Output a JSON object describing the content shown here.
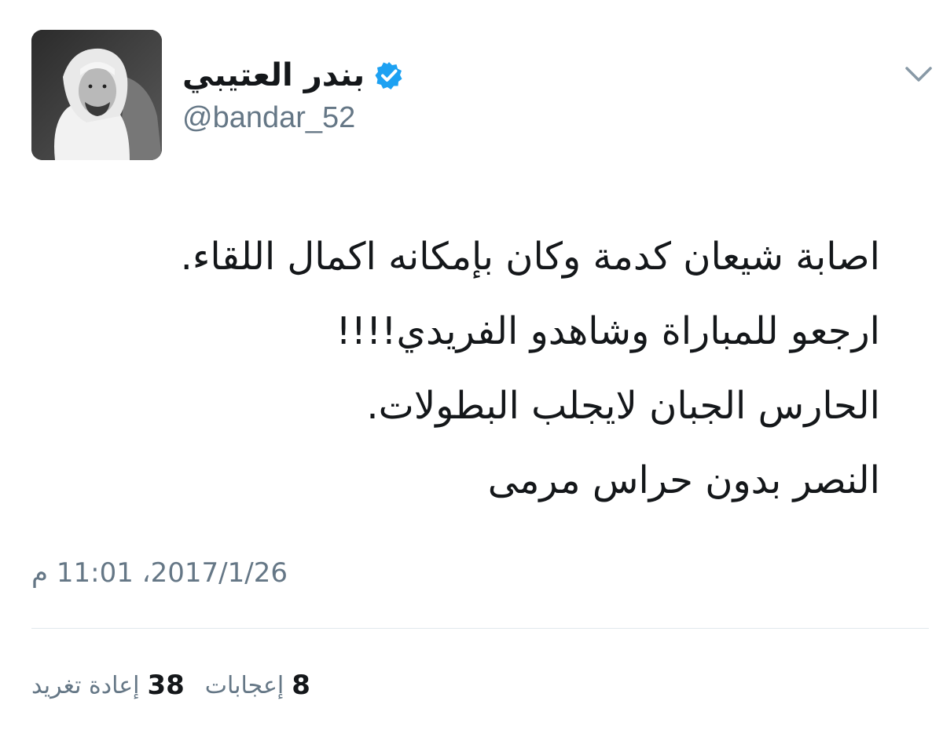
{
  "author": {
    "display_name": "بندر العتيبي",
    "handle": "@bandar_52",
    "verified": true,
    "avatar_icon": "profile-photo"
  },
  "menu": {
    "icon": "chevron-down-icon"
  },
  "tweet": {
    "lines": [
      "اصابة شيعان كدمة وكان بإمكانه اكمال اللقاء.",
      "ارجعو للمباراة وشاهدو الفريدي!!!!",
      "الحارس الجبان لايجلب البطولات.",
      "النصر بدون حراس مرمى"
    ],
    "timestamp": "2017/1/26، 11:01 م"
  },
  "stats": {
    "retweets_count": "38",
    "retweets_label": "إعادة تغريد",
    "likes_count": "8",
    "likes_label": "إعجابات"
  },
  "colors": {
    "verified_blue": "#1da1f2",
    "text_primary": "#14171a",
    "text_secondary": "#657786",
    "divider": "#e1e8ed"
  }
}
